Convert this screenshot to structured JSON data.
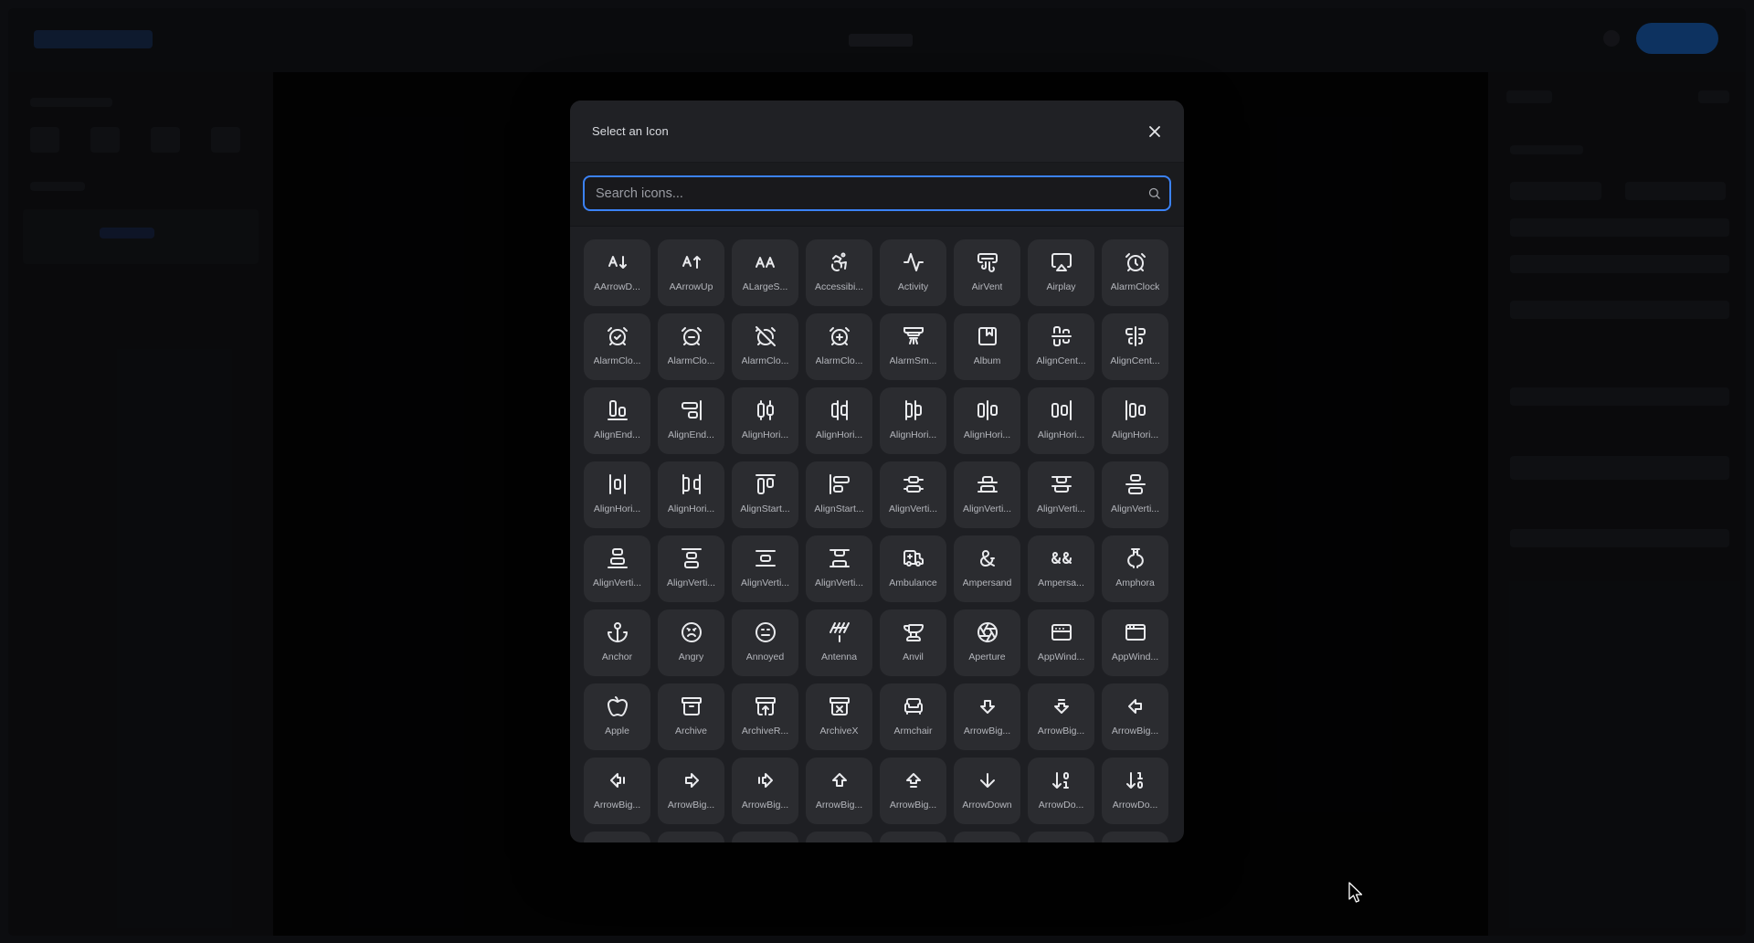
{
  "modal": {
    "title": "Select an Icon",
    "search_placeholder": "Search icons..."
  },
  "icons": [
    {
      "label": "AArrowD...",
      "icon": "a-arrow-down-icon"
    },
    {
      "label": "AArrowUp",
      "icon": "a-arrow-up-icon"
    },
    {
      "label": "ALargeS...",
      "icon": "a-large-small-icon"
    },
    {
      "label": "Accessibi...",
      "icon": "accessibility-icon"
    },
    {
      "label": "Activity",
      "icon": "activity-icon"
    },
    {
      "label": "AirVent",
      "icon": "air-vent-icon"
    },
    {
      "label": "Airplay",
      "icon": "airplay-icon"
    },
    {
      "label": "AlarmClock",
      "icon": "alarm-clock-icon"
    },
    {
      "label": "AlarmClo...",
      "icon": "alarm-clock-check-icon"
    },
    {
      "label": "AlarmClo...",
      "icon": "alarm-clock-minus-icon"
    },
    {
      "label": "AlarmClo...",
      "icon": "alarm-clock-off-icon"
    },
    {
      "label": "AlarmClo...",
      "icon": "alarm-clock-plus-icon"
    },
    {
      "label": "AlarmSm...",
      "icon": "alarm-smoke-icon"
    },
    {
      "label": "Album",
      "icon": "album-icon"
    },
    {
      "label": "AlignCent...",
      "icon": "align-center-horizontal-icon"
    },
    {
      "label": "AlignCent...",
      "icon": "align-center-vertical-icon"
    },
    {
      "label": "AlignEnd...",
      "icon": "align-end-horizontal-icon"
    },
    {
      "label": "AlignEnd...",
      "icon": "align-end-vertical-icon"
    },
    {
      "label": "AlignHori...",
      "icon": "align-horizontal-distribute-center-icon"
    },
    {
      "label": "AlignHori...",
      "icon": "align-horizontal-distribute-end-icon"
    },
    {
      "label": "AlignHori...",
      "icon": "align-horizontal-distribute-start-icon"
    },
    {
      "label": "AlignHori...",
      "icon": "align-horizontal-justify-center-icon"
    },
    {
      "label": "AlignHori...",
      "icon": "align-horizontal-justify-end-icon"
    },
    {
      "label": "AlignHori...",
      "icon": "align-horizontal-justify-start-icon"
    },
    {
      "label": "AlignHori...",
      "icon": "align-horizontal-space-around-icon"
    },
    {
      "label": "AlignHori...",
      "icon": "align-horizontal-space-between-icon"
    },
    {
      "label": "AlignStart...",
      "icon": "align-start-horizontal-icon"
    },
    {
      "label": "AlignStart...",
      "icon": "align-start-vertical-icon"
    },
    {
      "label": "AlignVerti...",
      "icon": "align-vertical-distribute-center-icon"
    },
    {
      "label": "AlignVerti...",
      "icon": "align-vertical-distribute-end-icon"
    },
    {
      "label": "AlignVerti...",
      "icon": "align-vertical-distribute-start-icon"
    },
    {
      "label": "AlignVerti...",
      "icon": "align-vertical-justify-center-icon"
    },
    {
      "label": "AlignVerti...",
      "icon": "align-vertical-justify-end-icon"
    },
    {
      "label": "AlignVerti...",
      "icon": "align-vertical-justify-start-icon"
    },
    {
      "label": "AlignVerti...",
      "icon": "align-vertical-space-around-icon"
    },
    {
      "label": "AlignVerti...",
      "icon": "align-vertical-space-between-icon"
    },
    {
      "label": "Ambulance",
      "icon": "ambulance-icon"
    },
    {
      "label": "Ampersand",
      "icon": "ampersand-icon"
    },
    {
      "label": "Ampersa...",
      "icon": "ampersands-icon"
    },
    {
      "label": "Amphora",
      "icon": "amphora-icon"
    },
    {
      "label": "Anchor",
      "icon": "anchor-icon"
    },
    {
      "label": "Angry",
      "icon": "angry-icon"
    },
    {
      "label": "Annoyed",
      "icon": "annoyed-icon"
    },
    {
      "label": "Antenna",
      "icon": "antenna-icon"
    },
    {
      "label": "Anvil",
      "icon": "anvil-icon"
    },
    {
      "label": "Aperture",
      "icon": "aperture-icon"
    },
    {
      "label": "AppWind...",
      "icon": "app-window-mac-icon"
    },
    {
      "label": "AppWind...",
      "icon": "app-window-icon"
    },
    {
      "label": "Apple",
      "icon": "apple-icon"
    },
    {
      "label": "Archive",
      "icon": "archive-icon"
    },
    {
      "label": "ArchiveR...",
      "icon": "archive-restore-icon"
    },
    {
      "label": "ArchiveX",
      "icon": "archive-x-icon"
    },
    {
      "label": "Armchair",
      "icon": "armchair-icon"
    },
    {
      "label": "ArrowBig...",
      "icon": "arrow-big-down-icon"
    },
    {
      "label": "ArrowBig...",
      "icon": "arrow-big-down-dash-icon"
    },
    {
      "label": "ArrowBig...",
      "icon": "arrow-big-left-icon"
    },
    {
      "label": "ArrowBig...",
      "icon": "arrow-big-left-dash-icon"
    },
    {
      "label": "ArrowBig...",
      "icon": "arrow-big-right-icon"
    },
    {
      "label": "ArrowBig...",
      "icon": "arrow-big-right-dash-icon"
    },
    {
      "label": "ArrowBig...",
      "icon": "arrow-big-up-icon"
    },
    {
      "label": "ArrowBig...",
      "icon": "arrow-big-up-dash-icon"
    },
    {
      "label": "ArrowDown",
      "icon": "arrow-down-icon"
    },
    {
      "label": "ArrowDo...",
      "icon": "arrow-down-0-1-icon"
    },
    {
      "label": "ArrowDo...",
      "icon": "arrow-down-1-0-icon"
    }
  ],
  "colors": {
    "accent": "#3b82f6",
    "tile_bg": "#2b2c30",
    "modal_bg": "#1e1f23"
  }
}
